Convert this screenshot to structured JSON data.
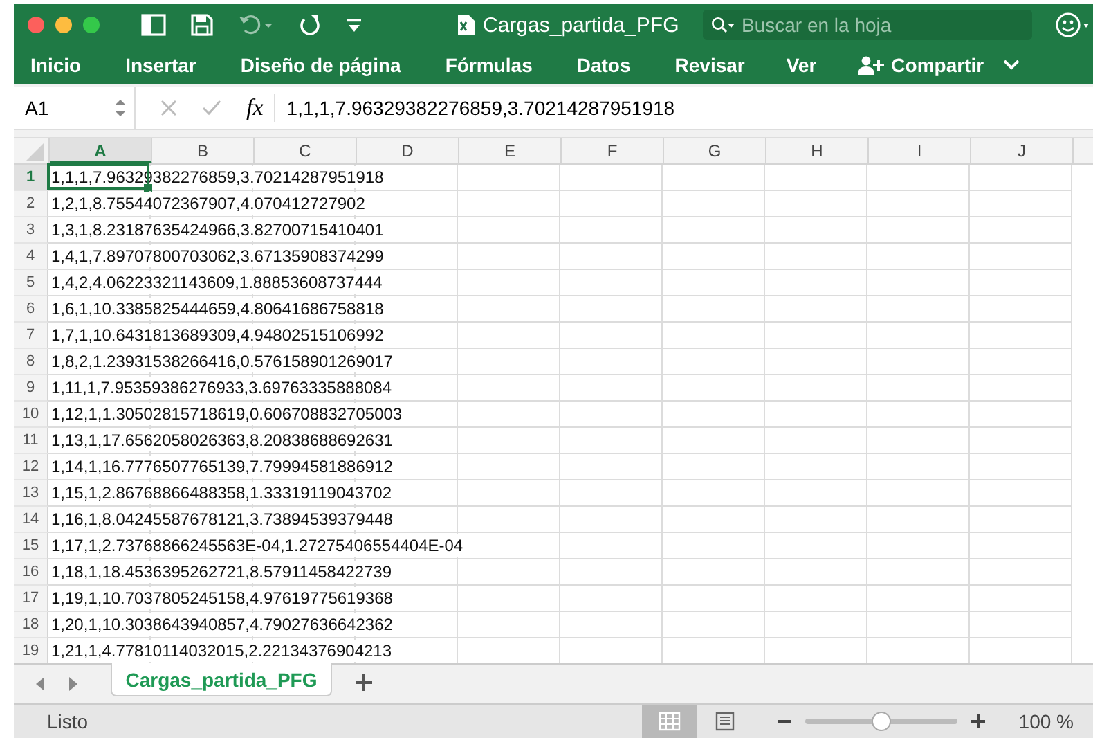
{
  "window": {
    "title": "Cargas_partida_PFG"
  },
  "search": {
    "placeholder": "Buscar en la hoja"
  },
  "ribbon_tabs": [
    "Inicio",
    "Insertar",
    "Diseño de página",
    "Fórmulas",
    "Datos",
    "Revisar",
    "Ver"
  ],
  "share_button": "Compartir",
  "formula_bar": {
    "name_box": "A1",
    "fx": "fx",
    "value": "1,1,1,7.96329382276859,3.70214287951918"
  },
  "columns": [
    {
      "label": "A",
      "selected": true
    },
    {
      "label": "B",
      "selected": false
    },
    {
      "label": "C",
      "selected": false
    },
    {
      "label": "D",
      "selected": false
    },
    {
      "label": "E",
      "selected": false
    },
    {
      "label": "F",
      "selected": false
    },
    {
      "label": "G",
      "selected": false
    },
    {
      "label": "H",
      "selected": false
    },
    {
      "label": "I",
      "selected": false
    },
    {
      "label": "J",
      "selected": false
    }
  ],
  "rows": [
    {
      "number": "1",
      "value": "1,1,1,7.96329382276859,3.70214287951918",
      "selected": true
    },
    {
      "number": "2",
      "value": "1,2,1,8.75544072367907,4.070412727902",
      "selected": false
    },
    {
      "number": "3",
      "value": "1,3,1,8.23187635424966,3.82700715410401",
      "selected": false
    },
    {
      "number": "4",
      "value": "1,4,1,7.89707800703062,3.67135908374299",
      "selected": false
    },
    {
      "number": "5",
      "value": "1,4,2,4.06223321143609,1.88853608737444",
      "selected": false
    },
    {
      "number": "6",
      "value": "1,6,1,10.3385825444659,4.80641686758818",
      "selected": false
    },
    {
      "number": "7",
      "value": "1,7,1,10.6431813689309,4.94802515106992",
      "selected": false
    },
    {
      "number": "8",
      "value": "1,8,2,1.23931538266416,0.576158901269017",
      "selected": false
    },
    {
      "number": "9",
      "value": "1,11,1,7.95359386276933,3.69763335888084",
      "selected": false
    },
    {
      "number": "10",
      "value": "1,12,1,1.30502815718619,0.606708832705003",
      "selected": false
    },
    {
      "number": "11",
      "value": "1,13,1,17.6562058026363,8.20838688692631",
      "selected": false
    },
    {
      "number": "12",
      "value": "1,14,1,16.7776507765139,7.79994581886912",
      "selected": false
    },
    {
      "number": "13",
      "value": "1,15,1,2.86768866488358,1.33319119043702",
      "selected": false
    },
    {
      "number": "14",
      "value": "1,16,1,8.04245587678121,3.73894539379448",
      "selected": false
    },
    {
      "number": "15",
      "value": "1,17,1,2.73768866245563E-04,1.27275406554404E-04",
      "selected": false
    },
    {
      "number": "16",
      "value": "1,18,1,18.4536395262721,8.57911458422739",
      "selected": false
    },
    {
      "number": "17",
      "value": "1,19,1,10.7037805245158,4.97619775619368",
      "selected": false
    },
    {
      "number": "18",
      "value": "1,20,1,10.3038643940857,4.79027636642362",
      "selected": false
    },
    {
      "number": "19",
      "value": "1,21,1,4.77810114032015,2.22134376904213",
      "selected": false
    }
  ],
  "sheet_tabs": [
    {
      "label": "Cargas_partida_PFG",
      "selected": true
    }
  ],
  "status_bar": {
    "status": "Listo",
    "views": [
      {
        "kind": "normal",
        "selected": true
      },
      {
        "kind": "page",
        "selected": false
      }
    ],
    "zoom": {
      "level": 0.5
    },
    "zoom_text": "100 %"
  }
}
